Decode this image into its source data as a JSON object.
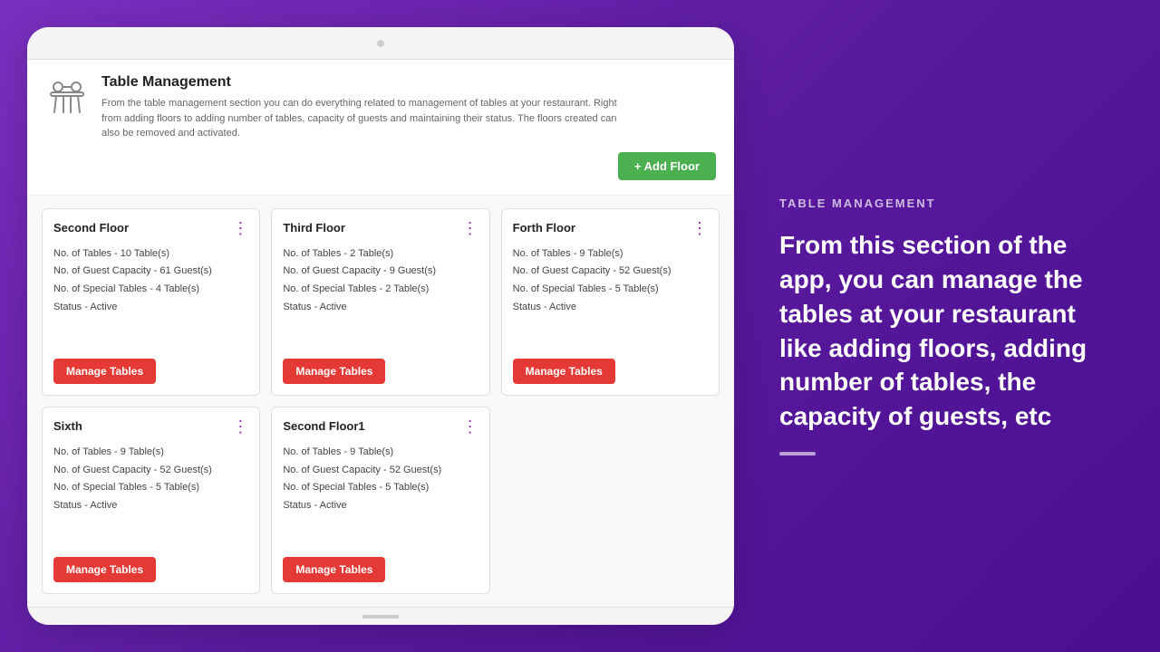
{
  "right_panel": {
    "section_label": "TABLE MANAGEMENT",
    "description": "From this section of the app, you can manage the tables at your restaurant like adding floors, adding number of tables, the capacity of guests, etc"
  },
  "header": {
    "title": "Table Management",
    "description": "From the table management section you can do everything related to management of tables at your restaurant. Right from adding floors to adding number of tables, capacity of guests and maintaining their status. The floors created can also be removed and activated.",
    "add_floor_button": "+ Add Floor"
  },
  "floors": [
    {
      "id": 1,
      "name": "Second Floor",
      "tables": "10 Table(s)",
      "guest_capacity": "61 Guest(s)",
      "special_tables": "4 Table(s)",
      "status": "Active",
      "manage_label": "Manage Tables"
    },
    {
      "id": 2,
      "name": "Third Floor",
      "tables": "2 Table(s)",
      "guest_capacity": "9 Guest(s)",
      "special_tables": "2 Table(s)",
      "status": "Active",
      "manage_label": "Manage Tables"
    },
    {
      "id": 3,
      "name": "Forth Floor",
      "tables": "9 Table(s)",
      "guest_capacity": "52 Guest(s)",
      "special_tables": "5 Table(s)",
      "status": "Active",
      "manage_label": "Manage Tables"
    },
    {
      "id": 4,
      "name": "Sixth",
      "tables": "9 Table(s)",
      "guest_capacity": "52 Guest(s)",
      "special_tables": "5 Table(s)",
      "status": "Active",
      "manage_label": "Manage Tables"
    },
    {
      "id": 5,
      "name": "Second Floor1",
      "tables": "9 Table(s)",
      "guest_capacity": "52 Guest(s)",
      "special_tables": "5 Table(s)",
      "status": "Active",
      "manage_label": "Manage Tables"
    }
  ],
  "labels": {
    "no_of_tables": "No. of Tables - ",
    "no_of_guest_capacity": "No. of Guest Capacity - ",
    "no_of_special_tables": "No. of Special Tables - ",
    "status": "Status - "
  }
}
